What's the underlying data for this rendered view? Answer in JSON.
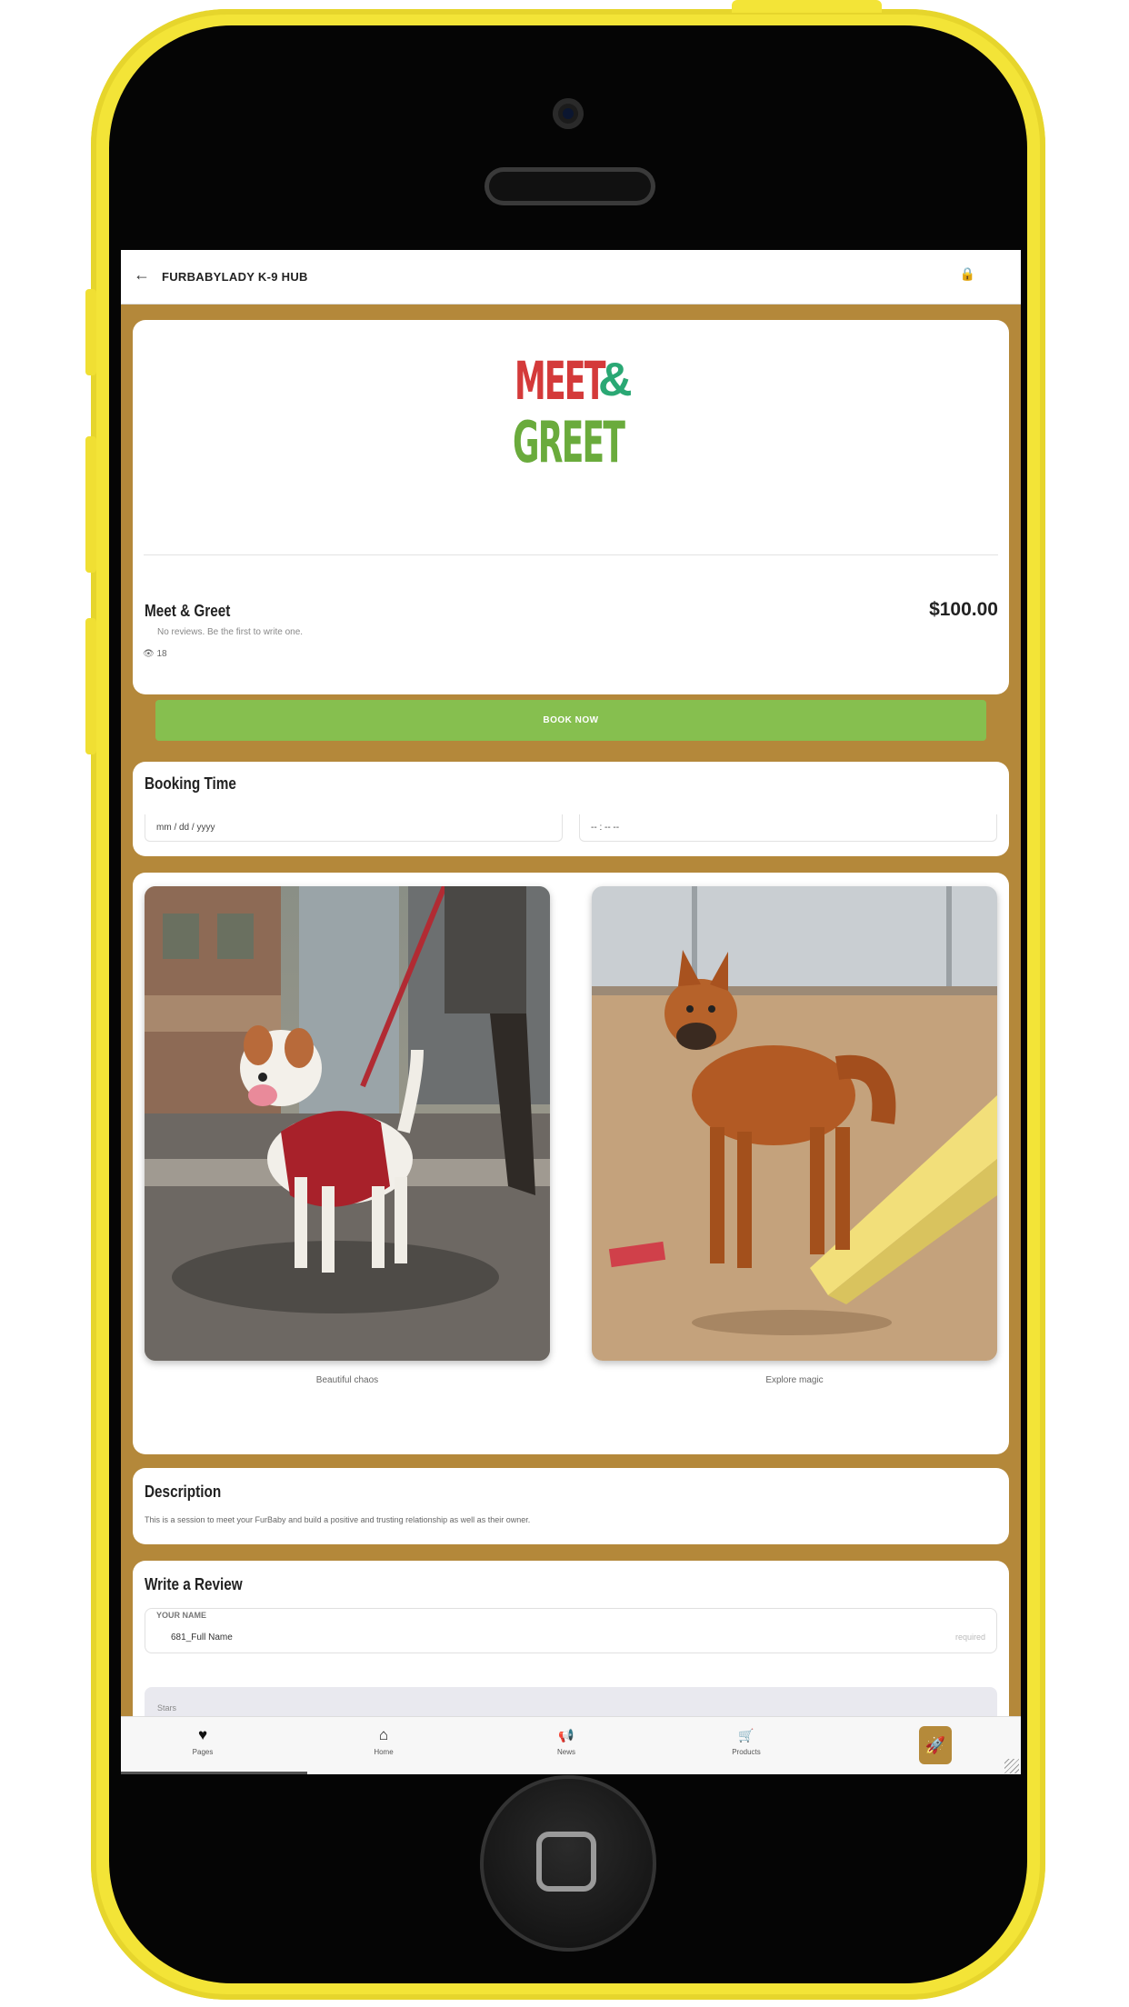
{
  "app": {
    "title": "FURBABYLADY K-9 HUB",
    "back_icon": "arrow-left-icon",
    "lock_icon": "lock-icon"
  },
  "product": {
    "logo_text_meet": "MEET",
    "logo_text_amp": "&",
    "logo_text_greet": "GREET",
    "name": "Meet & Greet",
    "price": "$100.00",
    "reviews_note": "No reviews. Be the first to write one.",
    "views": "18",
    "book_label": "BOOK NOW"
  },
  "booking": {
    "title": "Booking Time",
    "date_placeholder": "mm / dd / yyyy",
    "time_placeholder": "-- : -- --"
  },
  "gallery": {
    "items": [
      {
        "caption": "Beautiful chaos"
      },
      {
        "caption": "Explore magic"
      }
    ]
  },
  "description": {
    "title": "Description",
    "text": "This is a session to meet your FurBaby and build a positive and trusting relationship as well as their owner."
  },
  "review": {
    "title": "Write a Review",
    "name_label": "YOUR NAME",
    "name_value": "681_Full Name",
    "name_required": "required",
    "stars_label": "Stars"
  },
  "nav": {
    "items": [
      {
        "label": "Pages",
        "icon": "heart-icon",
        "glyph": "♥"
      },
      {
        "label": "Home",
        "icon": "home-icon",
        "glyph": "⌂"
      },
      {
        "label": "News",
        "icon": "megaphone-icon",
        "glyph": "📢"
      },
      {
        "label": "Products",
        "icon": "cart-icon",
        "glyph": "🛒"
      }
    ],
    "rocket_icon": "rocket-icon"
  },
  "colors": {
    "page_background": "#b4883a",
    "book_button": "#86bf4f",
    "phone_frame": "#f3e437",
    "rocket_button": "#b58a3a"
  }
}
